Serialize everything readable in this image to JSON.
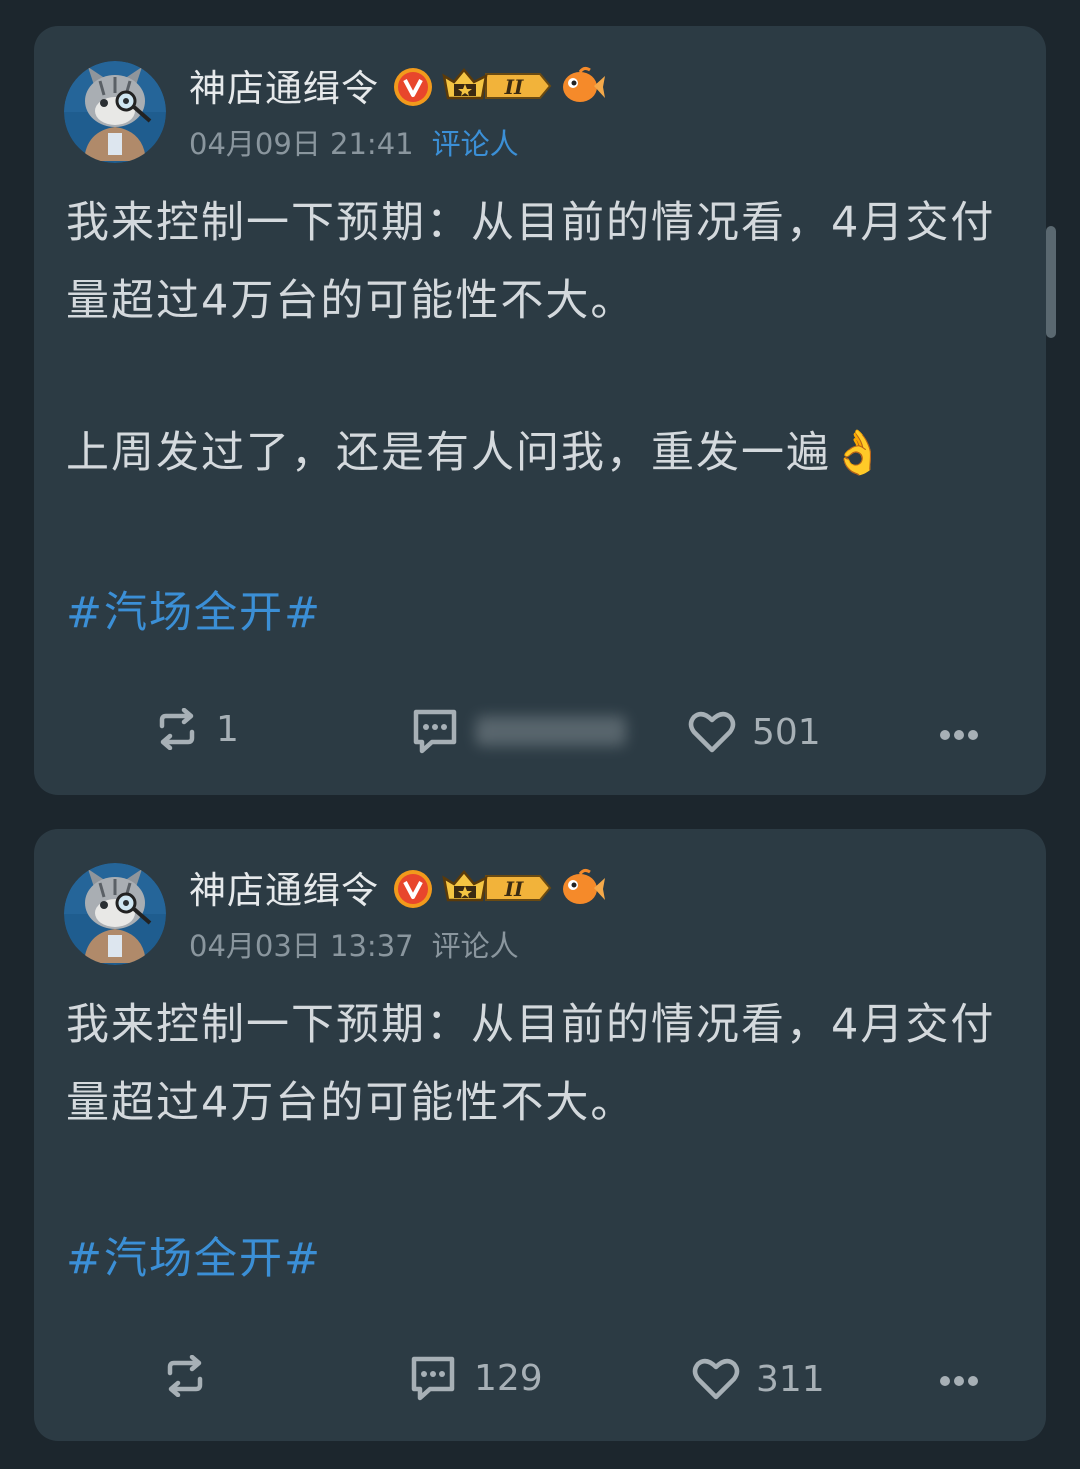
{
  "posts": [
    {
      "author": "神店通缉令",
      "time": "04月09日 21:41",
      "role": "评论人",
      "role_color": "#3b8fd6",
      "paragraph1": "我来控制一下预期：从目前的情况看，4月交付量超过4万台的可能性不大。",
      "paragraph2": "上周发过了，还是有人问我，重发一遍👌",
      "hashtag": "#汽场全开#",
      "repost_count": "1",
      "comment_count": "·",
      "like_count": "501"
    },
    {
      "author": "神店通缉令",
      "time": "04月03日 13:37",
      "role": "评论人",
      "role_color": "#8a969e",
      "paragraph1": "我来控制一下预期：从目前的情况看，4月交付量超过4万台的可能性不大。",
      "hashtag": "#汽场全开#",
      "repost_count": "",
      "comment_count": "129",
      "like_count": "311"
    }
  ],
  "icons": {
    "verified": "verified-v-icon",
    "level": "crown-level-badge",
    "fan": "fish-fan-badge",
    "repost": "repost-icon",
    "comment": "comment-icon",
    "like": "heart-icon",
    "more": "more-dots-icon"
  },
  "level_label": "II"
}
